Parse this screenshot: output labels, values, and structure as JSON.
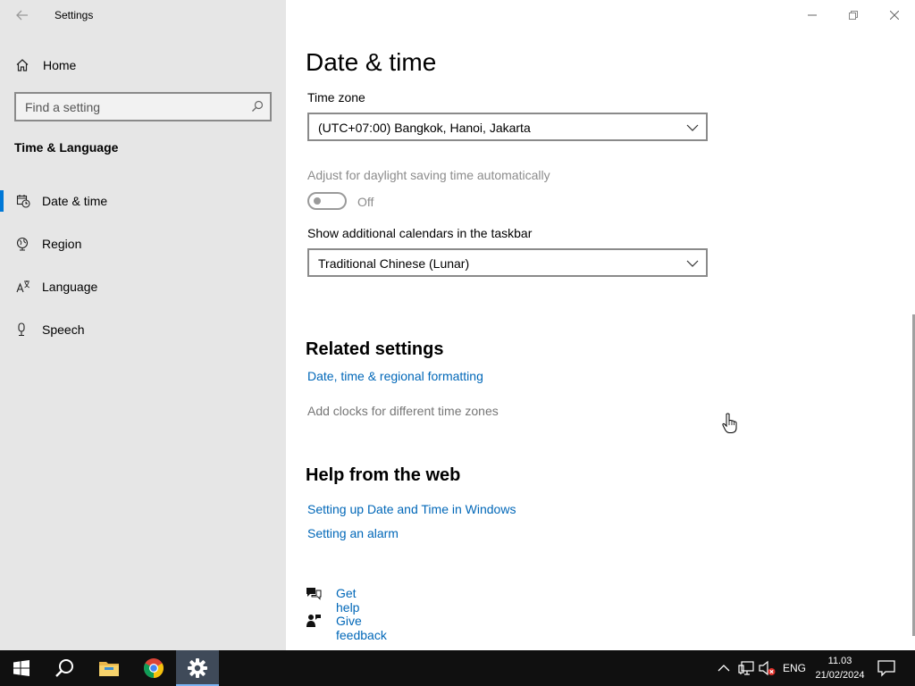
{
  "window": {
    "title": "Settings",
    "controls": [
      "minimize-icon",
      "restore-icon",
      "close-icon"
    ]
  },
  "sidebar": {
    "home_label": "Home",
    "search_placeholder": "Find a setting",
    "section_title": "Time & Language",
    "items": [
      {
        "label": "Date & time",
        "icon": "calendar-clock-icon",
        "active": true
      },
      {
        "label": "Region",
        "icon": "globe-icon",
        "active": false
      },
      {
        "label": "Language",
        "icon": "language-icon",
        "active": false
      },
      {
        "label": "Speech",
        "icon": "microphone-icon",
        "active": false
      }
    ]
  },
  "main": {
    "title": "Date & time",
    "timezone": {
      "label": "Time zone",
      "value": "(UTC+07:00) Bangkok, Hanoi, Jakarta"
    },
    "daylight": {
      "label": "Adjust for daylight saving time automatically",
      "state": "Off"
    },
    "calendars": {
      "label": "Show additional calendars in the taskbar",
      "value": "Traditional Chinese (Lunar)"
    },
    "related": {
      "heading": "Related settings",
      "links": [
        "Date, time & regional formatting",
        "Add clocks for different time zones"
      ]
    },
    "help": {
      "heading": "Help from the web",
      "links": [
        "Setting up Date and Time in Windows",
        "Setting an alarm"
      ]
    },
    "support": {
      "get_help": "Get help",
      "give_feedback": "Give feedback"
    }
  },
  "taskbar": {
    "apps": [
      "windows-start-icon",
      "search-icon",
      "file-explorer-icon",
      "chrome-icon",
      "settings-gear-icon"
    ],
    "language": "ENG",
    "time": "11.03",
    "date": "21/02/2024"
  },
  "colors": {
    "accent": "#0078d7",
    "link": "#0067b8",
    "sidebar_bg": "#e6e6e6",
    "taskbar_bg": "#101010"
  }
}
